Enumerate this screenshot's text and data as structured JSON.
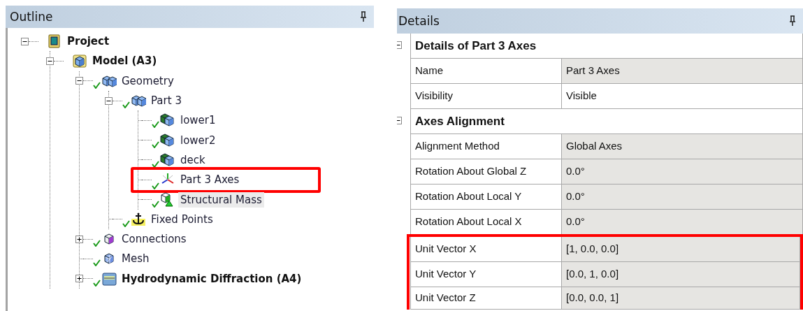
{
  "outline": {
    "title": "Outline",
    "tree": [
      {
        "label": "Project",
        "kind": "project",
        "bold": true,
        "checked": false,
        "expanded": true,
        "children": [
          {
            "label": "Model (A3)",
            "kind": "model",
            "bold": true,
            "checked": false,
            "expanded": true,
            "children": [
              {
                "label": "Geometry",
                "kind": "geometry",
                "checked": true,
                "expanded": true,
                "children": [
                  {
                    "label": "Part 3",
                    "kind": "geometry",
                    "checked": true,
                    "expanded": true,
                    "children": [
                      {
                        "label": "lower1",
                        "kind": "body",
                        "checked": true
                      },
                      {
                        "label": "lower2",
                        "kind": "body",
                        "checked": true
                      },
                      {
                        "label": "deck",
                        "kind": "body",
                        "checked": true
                      },
                      {
                        "label": "Part 3 Axes",
                        "kind": "axes",
                        "checked": true,
                        "highlighted": true
                      },
                      {
                        "label": "Structural Mass",
                        "kind": "mass",
                        "checked": true,
                        "hovered": true
                      }
                    ]
                  },
                  {
                    "label": "Fixed Points",
                    "kind": "fixed",
                    "checked": true
                  }
                ]
              },
              {
                "label": "Connections",
                "kind": "connections",
                "checked": true,
                "expanded": false
              },
              {
                "label": "Mesh",
                "kind": "mesh",
                "checked": true
              },
              {
                "label": "Hydrodynamic Diffraction (A4)",
                "kind": "hydro",
                "bold": true,
                "checked": true,
                "expanded": false
              }
            ]
          }
        ]
      }
    ]
  },
  "details": {
    "title": "Details",
    "sections": [
      {
        "title": "Details of Part 3 Axes",
        "expanded": true,
        "rows": [
          {
            "label": "Name",
            "value": "Part 3 Axes",
            "readonly": true
          },
          {
            "label": "Visibility",
            "value": "Visible",
            "readonly": false
          }
        ]
      },
      {
        "title": "Axes Alignment",
        "expanded": true,
        "rows": [
          {
            "label": "Alignment Method",
            "value": "Global Axes",
            "readonly": true
          },
          {
            "label": "Rotation About Global Z",
            "value": "0.0°",
            "readonly": true
          },
          {
            "label": "Rotation About Local Y",
            "value": "0.0°",
            "readonly": true
          },
          {
            "label": "Rotation About Local X",
            "value": "0.0°",
            "readonly": true
          },
          {
            "label": "Unit Vector X",
            "value": "[1, 0.0, 0.0]",
            "readonly": true,
            "highlighted": true
          },
          {
            "label": "Unit Vector Y",
            "value": "[0.0, 1, 0.0]",
            "readonly": true,
            "highlighted": true
          },
          {
            "label": "Unit Vector Z",
            "value": "[0.0, 0.0, 1]",
            "readonly": true,
            "highlighted": true
          }
        ]
      }
    ]
  }
}
